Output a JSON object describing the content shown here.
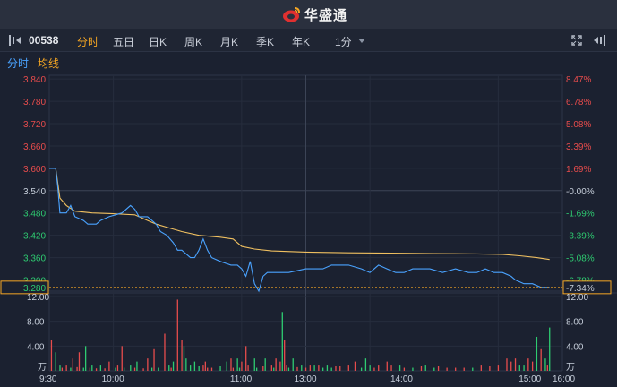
{
  "app": {
    "brand": "华盛通"
  },
  "toolbar": {
    "stock_code": "00538",
    "tabs": [
      "分时",
      "五日",
      "日K",
      "周K",
      "月K",
      "季K",
      "年K"
    ],
    "active_tab": "分时",
    "interval": "1分"
  },
  "legend": {
    "price_label": "分时",
    "avg_label": "均线"
  },
  "colors": {
    "up": "#e74c4c",
    "down": "#2ecc71",
    "neutral": "#c8d0dc",
    "price_line": "#4aa3ff",
    "avg_line": "#f0c060",
    "accent": "#f5a623"
  },
  "chart_data": {
    "type": "line",
    "price_axis": {
      "ticks": [
        "3.840",
        "3.780",
        "3.720",
        "3.660",
        "3.600",
        "3.540",
        "3.480",
        "3.420",
        "3.360",
        "3.300"
      ],
      "ylim": [
        3.27,
        3.85
      ],
      "prev_close": 3.54,
      "current": "3.280"
    },
    "pct_axis": {
      "ticks": [
        "8.47%",
        "6.78%",
        "5.08%",
        "3.39%",
        "1.69%",
        "-0.00%",
        "-1.69%",
        "-3.39%",
        "-5.08%",
        "-6.78%"
      ],
      "current": "-7.34%"
    },
    "time_axis": {
      "labels": [
        "9:30",
        "10:00",
        "11:00",
        "13:00",
        "14:00",
        "15:00",
        "16:00"
      ]
    },
    "volume_axis": {
      "ticks": [
        "12.00",
        "8.00",
        "4.00",
        "万"
      ],
      "ylim": [
        0,
        12
      ]
    },
    "series": [
      {
        "name": "分时",
        "points": [
          [
            0,
            3.6
          ],
          [
            3,
            3.6
          ],
          [
            4,
            3.55
          ],
          [
            5,
            3.48
          ],
          [
            8,
            3.48
          ],
          [
            10,
            3.5
          ],
          [
            12,
            3.47
          ],
          [
            16,
            3.46
          ],
          [
            18,
            3.45
          ],
          [
            22,
            3.45
          ],
          [
            24,
            3.46
          ],
          [
            28,
            3.47
          ],
          [
            34,
            3.48
          ],
          [
            38,
            3.5
          ],
          [
            40,
            3.49
          ],
          [
            42,
            3.47
          ],
          [
            46,
            3.47
          ],
          [
            50,
            3.45
          ],
          [
            52,
            3.43
          ],
          [
            55,
            3.42
          ],
          [
            58,
            3.4
          ],
          [
            60,
            3.38
          ],
          [
            62,
            3.38
          ],
          [
            64,
            3.37
          ],
          [
            66,
            3.36
          ],
          [
            68,
            3.36
          ],
          [
            70,
            3.38
          ],
          [
            72,
            3.41
          ],
          [
            74,
            3.38
          ],
          [
            76,
            3.36
          ],
          [
            80,
            3.35
          ],
          [
            85,
            3.34
          ],
          [
            88,
            3.34
          ],
          [
            90,
            3.33
          ],
          [
            92,
            3.31
          ],
          [
            94,
            3.35
          ],
          [
            96,
            3.29
          ],
          [
            98,
            3.27
          ],
          [
            100,
            3.31
          ],
          [
            102,
            3.32
          ],
          [
            106,
            3.32
          ],
          [
            112,
            3.32
          ],
          [
            120,
            3.33
          ],
          [
            128,
            3.33
          ],
          [
            132,
            3.34
          ],
          [
            140,
            3.34
          ],
          [
            146,
            3.33
          ],
          [
            150,
            3.32
          ],
          [
            154,
            3.34
          ],
          [
            158,
            3.33
          ],
          [
            162,
            3.32
          ],
          [
            166,
            3.32
          ],
          [
            170,
            3.33
          ],
          [
            178,
            3.33
          ],
          [
            184,
            3.32
          ],
          [
            190,
            3.33
          ],
          [
            196,
            3.32
          ],
          [
            200,
            3.32
          ],
          [
            204,
            3.33
          ],
          [
            208,
            3.32
          ],
          [
            212,
            3.32
          ],
          [
            216,
            3.31
          ],
          [
            218,
            3.3
          ],
          [
            222,
            3.29
          ],
          [
            226,
            3.29
          ],
          [
            230,
            3.28
          ],
          [
            234,
            3.28
          ]
        ]
      },
      {
        "name": "均线",
        "points": [
          [
            0,
            3.6
          ],
          [
            3,
            3.6
          ],
          [
            5,
            3.52
          ],
          [
            8,
            3.5
          ],
          [
            12,
            3.485
          ],
          [
            20,
            3.48
          ],
          [
            30,
            3.478
          ],
          [
            40,
            3.475
          ],
          [
            46,
            3.46
          ],
          [
            50,
            3.45
          ],
          [
            56,
            3.44
          ],
          [
            62,
            3.43
          ],
          [
            70,
            3.42
          ],
          [
            80,
            3.415
          ],
          [
            86,
            3.41
          ],
          [
            90,
            3.39
          ],
          [
            96,
            3.383
          ],
          [
            104,
            3.378
          ],
          [
            120,
            3.375
          ],
          [
            140,
            3.373
          ],
          [
            160,
            3.372
          ],
          [
            180,
            3.371
          ],
          [
            200,
            3.37
          ],
          [
            212,
            3.369
          ],
          [
            220,
            3.365
          ],
          [
            228,
            3.36
          ],
          [
            234,
            3.355
          ]
        ]
      },
      {
        "name": "volume",
        "bars": [
          [
            1,
            5,
            "up"
          ],
          [
            3,
            3,
            "down"
          ],
          [
            5,
            1,
            "down"
          ],
          [
            6,
            0.5,
            "up"
          ],
          [
            8,
            1,
            "up"
          ],
          [
            10,
            0.5,
            "down"
          ],
          [
            11,
            2,
            "up"
          ],
          [
            13,
            0.6,
            "up"
          ],
          [
            14,
            3,
            "up"
          ],
          [
            16,
            0.5,
            "down"
          ],
          [
            17,
            4,
            "down"
          ],
          [
            19,
            0.5,
            "up"
          ],
          [
            20,
            1,
            "down"
          ],
          [
            22,
            0.4,
            "up"
          ],
          [
            24,
            1,
            "down"
          ],
          [
            26,
            0.4,
            "up"
          ],
          [
            28,
            1.5,
            "up"
          ],
          [
            31,
            0.5,
            "down"
          ],
          [
            32,
            1,
            "up"
          ],
          [
            34,
            4,
            "up"
          ],
          [
            35,
            0.5,
            "down"
          ],
          [
            38,
            1,
            "down"
          ],
          [
            40,
            0.5,
            "up"
          ],
          [
            41,
            1.5,
            "down"
          ],
          [
            44,
            0.4,
            "up"
          ],
          [
            46,
            2,
            "up"
          ],
          [
            48,
            0.5,
            "down"
          ],
          [
            49,
            3.5,
            "up"
          ],
          [
            51,
            0.5,
            "down"
          ],
          [
            54,
            6,
            "up"
          ],
          [
            56,
            1,
            "down"
          ],
          [
            57,
            0.5,
            "up"
          ],
          [
            58,
            1.5,
            "down"
          ],
          [
            60,
            11.5,
            "up"
          ],
          [
            62,
            5,
            "up"
          ],
          [
            63,
            4,
            "down"
          ],
          [
            64,
            2,
            "down"
          ],
          [
            66,
            1,
            "down"
          ],
          [
            68,
            1.5,
            "down"
          ],
          [
            70,
            0.8,
            "down"
          ],
          [
            72,
            1,
            "up"
          ],
          [
            73,
            1.5,
            "up"
          ],
          [
            74,
            0.5,
            "up"
          ],
          [
            76,
            0.5,
            "up"
          ],
          [
            80,
            0.8,
            "down"
          ],
          [
            83,
            1.5,
            "down"
          ],
          [
            85,
            2,
            "up"
          ],
          [
            86,
            0.5,
            "up"
          ],
          [
            88,
            2,
            "down"
          ],
          [
            89,
            0.5,
            "down"
          ],
          [
            90,
            1.5,
            "up"
          ],
          [
            92,
            4,
            "up"
          ],
          [
            93,
            1,
            "up"
          ],
          [
            96,
            2,
            "down"
          ],
          [
            97,
            0.5,
            "down"
          ],
          [
            100,
            0.8,
            "up"
          ],
          [
            101,
            2,
            "down"
          ],
          [
            104,
            1,
            "up"
          ],
          [
            105,
            0.5,
            "down"
          ],
          [
            106,
            2,
            "up"
          ],
          [
            108,
            1.5,
            "up"
          ],
          [
            109,
            9.5,
            "down"
          ],
          [
            110,
            5,
            "up"
          ],
          [
            111,
            1,
            "up"
          ],
          [
            112,
            0.5,
            "down"
          ],
          [
            114,
            2,
            "down"
          ],
          [
            116,
            0.6,
            "up"
          ],
          [
            118,
            1,
            "down"
          ],
          [
            120,
            0.5,
            "up"
          ],
          [
            122,
            1,
            "up"
          ],
          [
            124,
            1,
            "down"
          ],
          [
            126,
            1,
            "up"
          ],
          [
            128,
            0.5,
            "down"
          ],
          [
            130,
            1,
            "down"
          ],
          [
            132,
            0.5,
            "down"
          ],
          [
            134,
            0.8,
            "up"
          ],
          [
            136,
            0.8,
            "up"
          ],
          [
            140,
            1,
            "up"
          ],
          [
            143,
            1.5,
            "up"
          ],
          [
            146,
            0.5,
            "down"
          ],
          [
            148,
            2,
            "down"
          ],
          [
            150,
            1,
            "down"
          ],
          [
            152,
            0.5,
            "up"
          ],
          [
            154,
            1,
            "up"
          ],
          [
            158,
            1.5,
            "up"
          ],
          [
            160,
            1,
            "up"
          ],
          [
            164,
            1,
            "down"
          ],
          [
            166,
            0.5,
            "up"
          ],
          [
            170,
            0.5,
            "down"
          ],
          [
            174,
            0.8,
            "up"
          ],
          [
            176,
            1,
            "down"
          ],
          [
            180,
            0.5,
            "down"
          ],
          [
            182,
            0.8,
            "up"
          ],
          [
            186,
            0.5,
            "up"
          ],
          [
            190,
            0.5,
            "up"
          ],
          [
            194,
            0.5,
            "up"
          ],
          [
            198,
            0.5,
            "down"
          ],
          [
            202,
            1,
            "up"
          ],
          [
            206,
            0.8,
            "up"
          ],
          [
            210,
            1,
            "up"
          ],
          [
            214,
            2,
            "up"
          ],
          [
            216,
            1.5,
            "up"
          ],
          [
            218,
            2,
            "up"
          ],
          [
            220,
            1,
            "down"
          ],
          [
            222,
            1,
            "down"
          ],
          [
            224,
            2,
            "up"
          ],
          [
            226,
            1.5,
            "up"
          ],
          [
            228,
            5.5,
            "down"
          ],
          [
            230,
            3.5,
            "up"
          ],
          [
            232,
            2,
            "down"
          ],
          [
            233,
            1,
            "up"
          ],
          [
            234,
            7,
            "down"
          ]
        ]
      }
    ]
  }
}
